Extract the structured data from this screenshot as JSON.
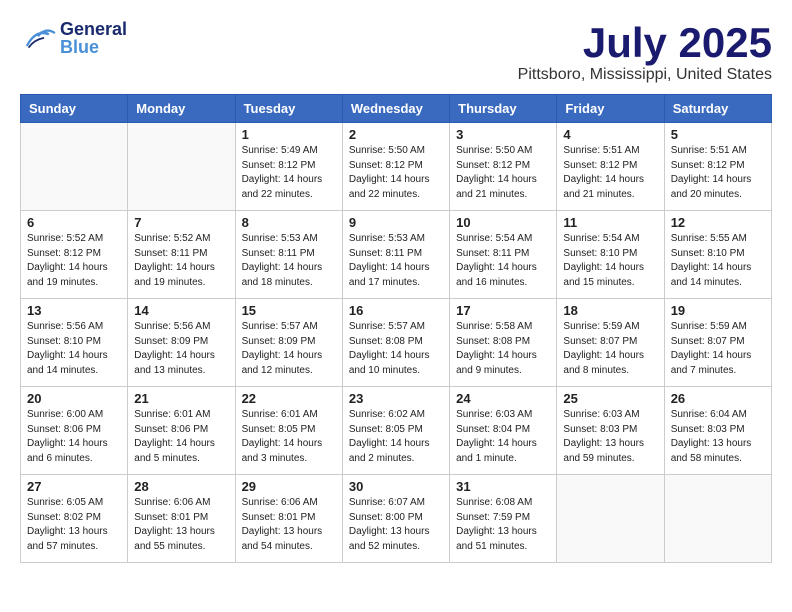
{
  "header": {
    "logo_general": "General",
    "logo_blue": "Blue",
    "month_title": "July 2025",
    "location": "Pittsboro, Mississippi, United States"
  },
  "weekdays": [
    "Sunday",
    "Monday",
    "Tuesday",
    "Wednesday",
    "Thursday",
    "Friday",
    "Saturday"
  ],
  "weeks": [
    [
      {
        "day": null
      },
      {
        "day": null
      },
      {
        "day": "1",
        "sunrise": "Sunrise: 5:49 AM",
        "sunset": "Sunset: 8:12 PM",
        "daylight": "Daylight: 14 hours and 22 minutes."
      },
      {
        "day": "2",
        "sunrise": "Sunrise: 5:50 AM",
        "sunset": "Sunset: 8:12 PM",
        "daylight": "Daylight: 14 hours and 22 minutes."
      },
      {
        "day": "3",
        "sunrise": "Sunrise: 5:50 AM",
        "sunset": "Sunset: 8:12 PM",
        "daylight": "Daylight: 14 hours and 21 minutes."
      },
      {
        "day": "4",
        "sunrise": "Sunrise: 5:51 AM",
        "sunset": "Sunset: 8:12 PM",
        "daylight": "Daylight: 14 hours and 21 minutes."
      },
      {
        "day": "5",
        "sunrise": "Sunrise: 5:51 AM",
        "sunset": "Sunset: 8:12 PM",
        "daylight": "Daylight: 14 hours and 20 minutes."
      }
    ],
    [
      {
        "day": "6",
        "sunrise": "Sunrise: 5:52 AM",
        "sunset": "Sunset: 8:12 PM",
        "daylight": "Daylight: 14 hours and 19 minutes."
      },
      {
        "day": "7",
        "sunrise": "Sunrise: 5:52 AM",
        "sunset": "Sunset: 8:11 PM",
        "daylight": "Daylight: 14 hours and 19 minutes."
      },
      {
        "day": "8",
        "sunrise": "Sunrise: 5:53 AM",
        "sunset": "Sunset: 8:11 PM",
        "daylight": "Daylight: 14 hours and 18 minutes."
      },
      {
        "day": "9",
        "sunrise": "Sunrise: 5:53 AM",
        "sunset": "Sunset: 8:11 PM",
        "daylight": "Daylight: 14 hours and 17 minutes."
      },
      {
        "day": "10",
        "sunrise": "Sunrise: 5:54 AM",
        "sunset": "Sunset: 8:11 PM",
        "daylight": "Daylight: 14 hours and 16 minutes."
      },
      {
        "day": "11",
        "sunrise": "Sunrise: 5:54 AM",
        "sunset": "Sunset: 8:10 PM",
        "daylight": "Daylight: 14 hours and 15 minutes."
      },
      {
        "day": "12",
        "sunrise": "Sunrise: 5:55 AM",
        "sunset": "Sunset: 8:10 PM",
        "daylight": "Daylight: 14 hours and 14 minutes."
      }
    ],
    [
      {
        "day": "13",
        "sunrise": "Sunrise: 5:56 AM",
        "sunset": "Sunset: 8:10 PM",
        "daylight": "Daylight: 14 hours and 14 minutes."
      },
      {
        "day": "14",
        "sunrise": "Sunrise: 5:56 AM",
        "sunset": "Sunset: 8:09 PM",
        "daylight": "Daylight: 14 hours and 13 minutes."
      },
      {
        "day": "15",
        "sunrise": "Sunrise: 5:57 AM",
        "sunset": "Sunset: 8:09 PM",
        "daylight": "Daylight: 14 hours and 12 minutes."
      },
      {
        "day": "16",
        "sunrise": "Sunrise: 5:57 AM",
        "sunset": "Sunset: 8:08 PM",
        "daylight": "Daylight: 14 hours and 10 minutes."
      },
      {
        "day": "17",
        "sunrise": "Sunrise: 5:58 AM",
        "sunset": "Sunset: 8:08 PM",
        "daylight": "Daylight: 14 hours and 9 minutes."
      },
      {
        "day": "18",
        "sunrise": "Sunrise: 5:59 AM",
        "sunset": "Sunset: 8:07 PM",
        "daylight": "Daylight: 14 hours and 8 minutes."
      },
      {
        "day": "19",
        "sunrise": "Sunrise: 5:59 AM",
        "sunset": "Sunset: 8:07 PM",
        "daylight": "Daylight: 14 hours and 7 minutes."
      }
    ],
    [
      {
        "day": "20",
        "sunrise": "Sunrise: 6:00 AM",
        "sunset": "Sunset: 8:06 PM",
        "daylight": "Daylight: 14 hours and 6 minutes."
      },
      {
        "day": "21",
        "sunrise": "Sunrise: 6:01 AM",
        "sunset": "Sunset: 8:06 PM",
        "daylight": "Daylight: 14 hours and 5 minutes."
      },
      {
        "day": "22",
        "sunrise": "Sunrise: 6:01 AM",
        "sunset": "Sunset: 8:05 PM",
        "daylight": "Daylight: 14 hours and 3 minutes."
      },
      {
        "day": "23",
        "sunrise": "Sunrise: 6:02 AM",
        "sunset": "Sunset: 8:05 PM",
        "daylight": "Daylight: 14 hours and 2 minutes."
      },
      {
        "day": "24",
        "sunrise": "Sunrise: 6:03 AM",
        "sunset": "Sunset: 8:04 PM",
        "daylight": "Daylight: 14 hours and 1 minute."
      },
      {
        "day": "25",
        "sunrise": "Sunrise: 6:03 AM",
        "sunset": "Sunset: 8:03 PM",
        "daylight": "Daylight: 13 hours and 59 minutes."
      },
      {
        "day": "26",
        "sunrise": "Sunrise: 6:04 AM",
        "sunset": "Sunset: 8:03 PM",
        "daylight": "Daylight: 13 hours and 58 minutes."
      }
    ],
    [
      {
        "day": "27",
        "sunrise": "Sunrise: 6:05 AM",
        "sunset": "Sunset: 8:02 PM",
        "daylight": "Daylight: 13 hours and 57 minutes."
      },
      {
        "day": "28",
        "sunrise": "Sunrise: 6:06 AM",
        "sunset": "Sunset: 8:01 PM",
        "daylight": "Daylight: 13 hours and 55 minutes."
      },
      {
        "day": "29",
        "sunrise": "Sunrise: 6:06 AM",
        "sunset": "Sunset: 8:01 PM",
        "daylight": "Daylight: 13 hours and 54 minutes."
      },
      {
        "day": "30",
        "sunrise": "Sunrise: 6:07 AM",
        "sunset": "Sunset: 8:00 PM",
        "daylight": "Daylight: 13 hours and 52 minutes."
      },
      {
        "day": "31",
        "sunrise": "Sunrise: 6:08 AM",
        "sunset": "Sunset: 7:59 PM",
        "daylight": "Daylight: 13 hours and 51 minutes."
      },
      {
        "day": null
      },
      {
        "day": null
      }
    ]
  ]
}
